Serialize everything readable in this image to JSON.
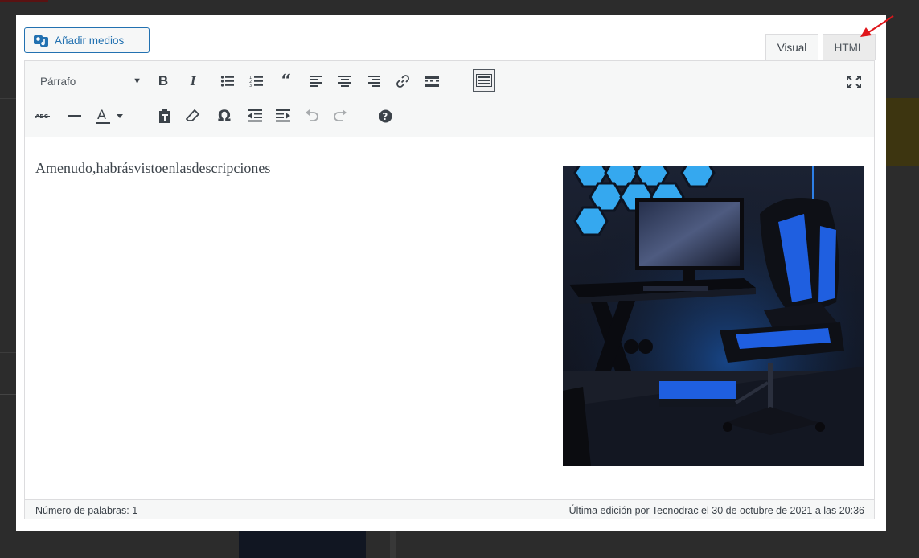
{
  "add_media": {
    "label": "Añadir medios"
  },
  "tabs": {
    "visual": "Visual",
    "html": "HTML"
  },
  "toolbar": {
    "format_select": "Párrafo",
    "row1": [
      "bold-button",
      "italic-button",
      "bulleted-list-button",
      "numbered-list-button",
      "blockquote-button",
      "align-left-button",
      "align-center-button",
      "align-right-button",
      "insert-link-button",
      "read-more-button",
      "toolbar-toggle-button"
    ],
    "row2": [
      "strikethrough-button",
      "horizontal-line-button",
      "text-color-button",
      "paste-as-text-button",
      "clear-formatting-button",
      "special-character-button",
      "decrease-indent-button",
      "increase-indent-button",
      "undo-button",
      "redo-button",
      "help-button"
    ]
  },
  "content": {
    "text": "Amenudo,habrásvistoenlasdescripciones",
    "image_alt_icon": "gaming-setup-image"
  },
  "status": {
    "word_count": "Número de palabras: 1",
    "last_edit": "Última edición por Tecnodrac el 30 de octubre de 2021 a las 20:36"
  },
  "colors": {
    "accent": "#2271b1",
    "toolbar_bg": "#f6f7f7",
    "border": "#dcdcde",
    "arrow": "#e0161b"
  }
}
